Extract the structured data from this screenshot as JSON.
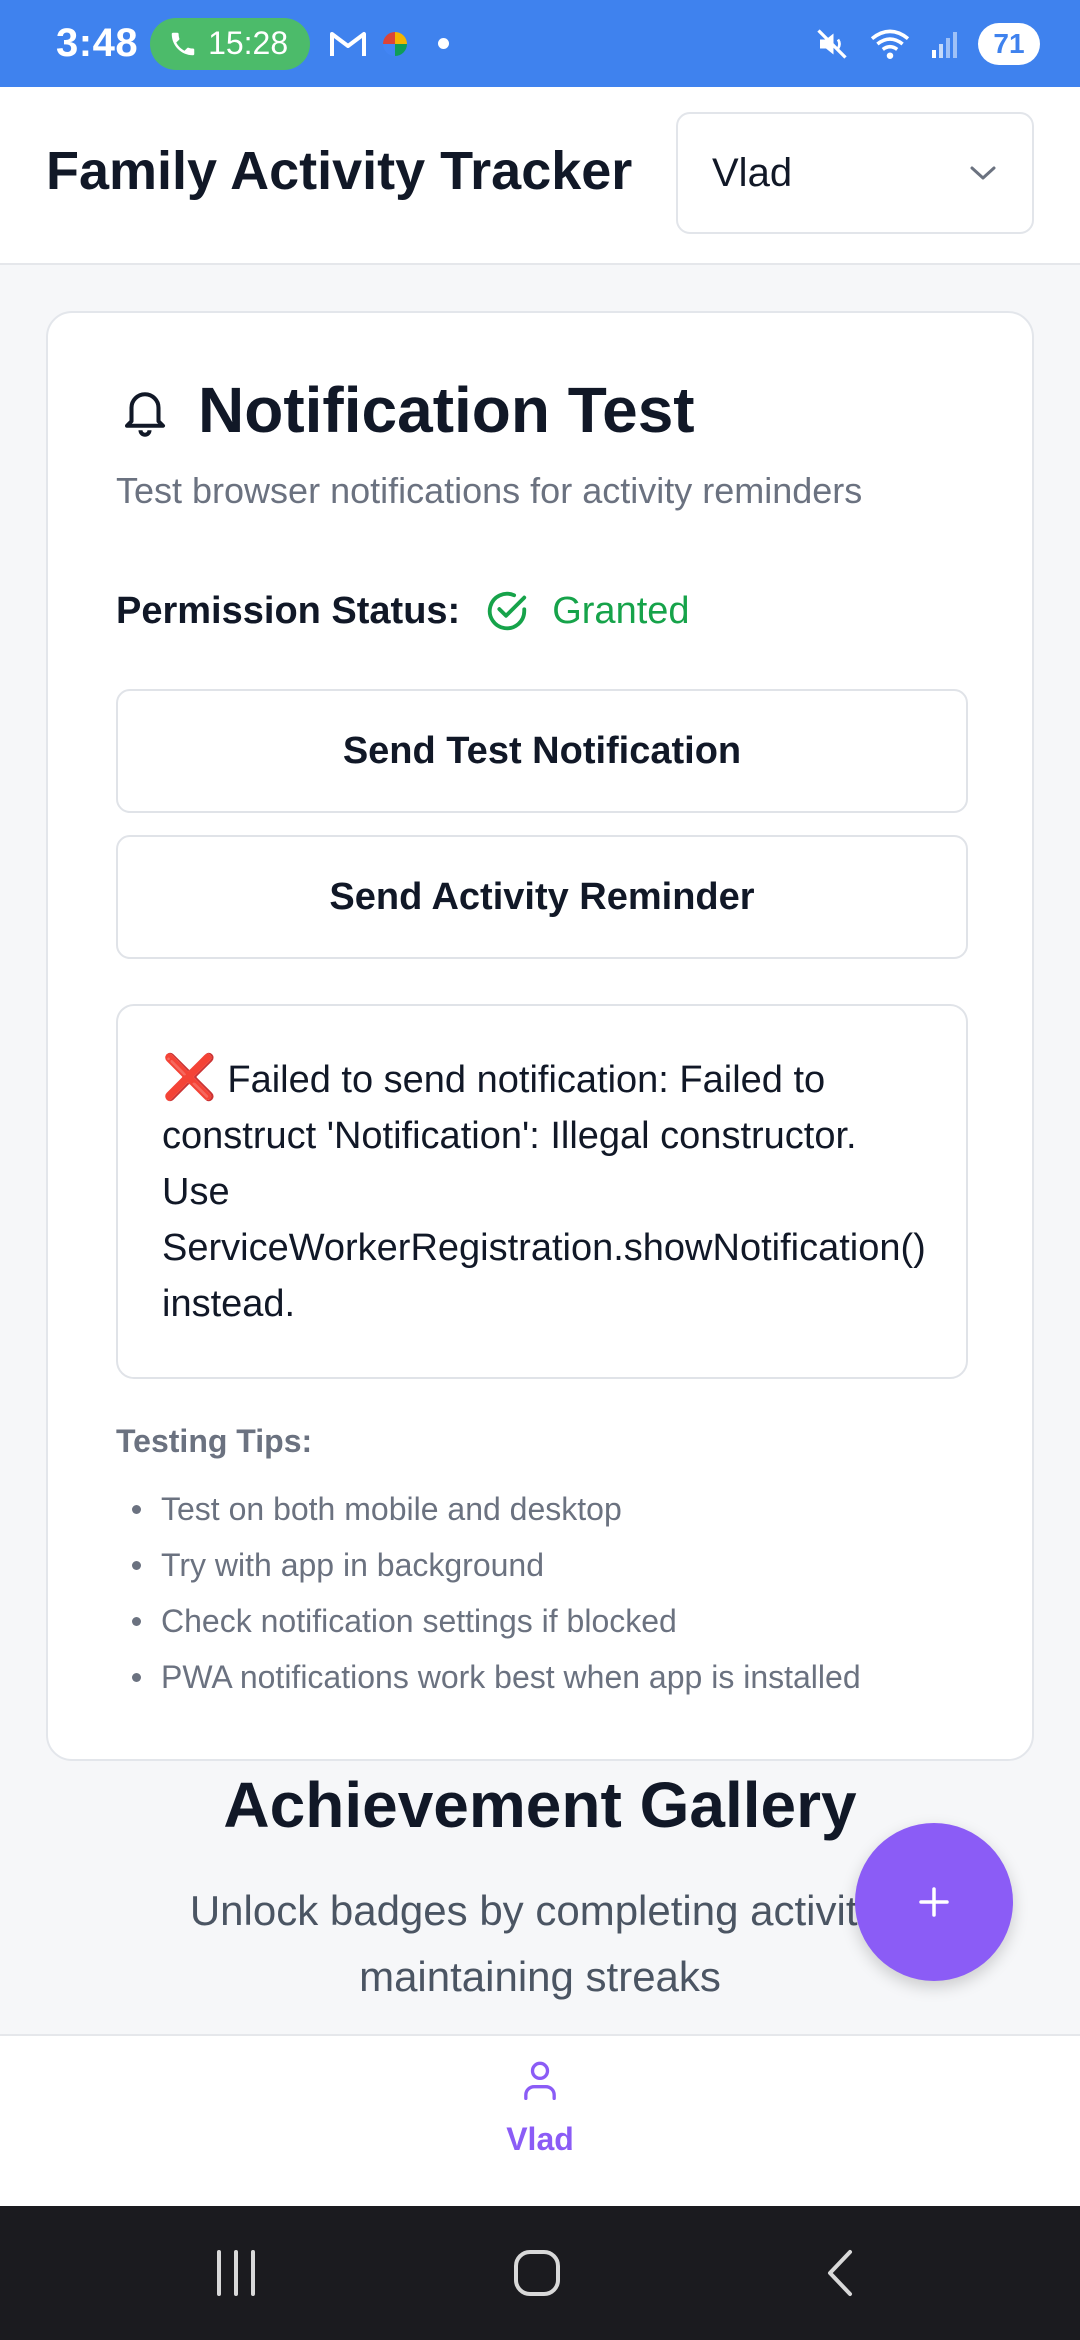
{
  "status_bar": {
    "time": "3:48",
    "call_duration": "15:28",
    "battery": "71",
    "icons": [
      "phone-icon",
      "gmail-icon",
      "google-photos-icon",
      "dot-icon",
      "mute-icon",
      "wifi-icon",
      "signal-icon"
    ]
  },
  "header": {
    "title": "Family Activity Tracker",
    "selected_user": "Vlad"
  },
  "card": {
    "title": "Notification Test",
    "subtitle": "Test browser notifications for activity reminders",
    "permission_label": "Permission Status:",
    "permission_value": "Granted",
    "send_test_label": "Send Test Notification",
    "send_reminder_label": "Send Activity Reminder",
    "error_icon": "❌",
    "error_lines": [
      "Failed to send notification: Failed to",
      "construct 'Notification': Illegal constructor.",
      "Use",
      "ServiceWorkerRegistration.showNotification()",
      "instead."
    ],
    "tips_title": "Testing Tips:",
    "tips": [
      "Test on both mobile and desktop",
      "Try with app in background",
      "Check notification settings if blocked",
      "PWA notifications work best when app is installed"
    ]
  },
  "achievements": {
    "title": "Achievement Gallery",
    "subtitle_line1": "Unlock badges by completing activitie",
    "subtitle_line2": "maintaining streaks"
  },
  "bottom_nav": {
    "items": [
      {
        "label": "Vlad",
        "icon": "user-icon",
        "active": true
      }
    ]
  },
  "colors": {
    "status_bar": "#3f82ee",
    "accent": "#8b5cf6",
    "granted": "#16a34a",
    "error": "#e11d48"
  }
}
